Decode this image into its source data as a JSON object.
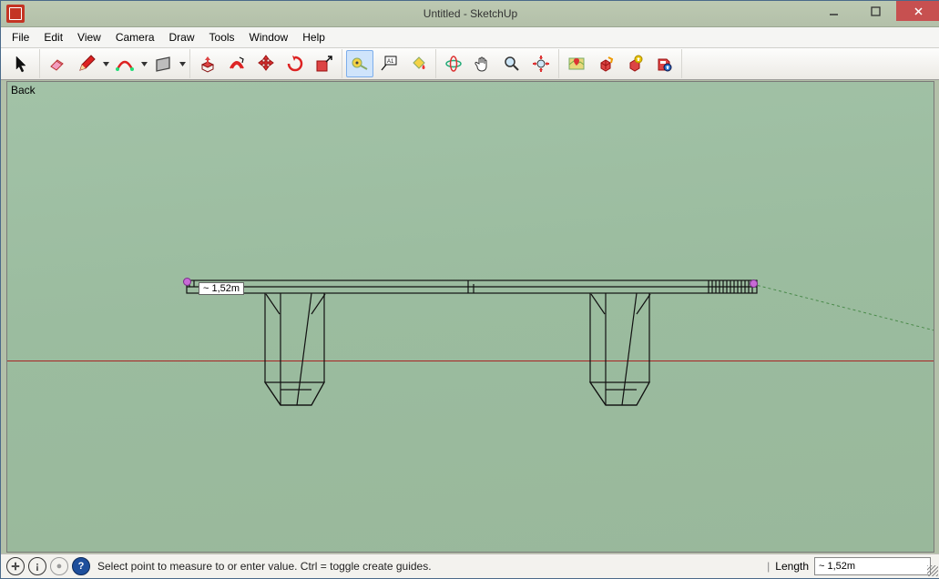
{
  "window": {
    "title": "Untitled - SketchUp"
  },
  "menus": [
    "File",
    "Edit",
    "View",
    "Camera",
    "Draw",
    "Tools",
    "Window",
    "Help"
  ],
  "viewport": {
    "label": "Back",
    "measure_tip": "~ 1,52m"
  },
  "status": {
    "hint": "Select point to measure to or enter value.  Ctrl = toggle create guides.",
    "vcb_label": "Length",
    "vcb_value": "~ 1,52m"
  },
  "icons": {
    "select": "select-arrow",
    "eraser": "eraser",
    "pencil": "pencil",
    "arc": "arc",
    "rect": "rectangle",
    "pushpull": "push-pull",
    "offset": "offset",
    "move": "move",
    "rotate": "rotate",
    "scale": "scale",
    "tape": "tape-measure",
    "text": "text-label",
    "paint": "paint-bucket",
    "orbit": "orbit",
    "pan": "pan",
    "zoom": "zoom",
    "zoomext": "zoom-extents",
    "addloc": "add-location",
    "getmodels": "get-models",
    "uploadcomp": "upload-component",
    "uploadmodel": "upload-model"
  }
}
